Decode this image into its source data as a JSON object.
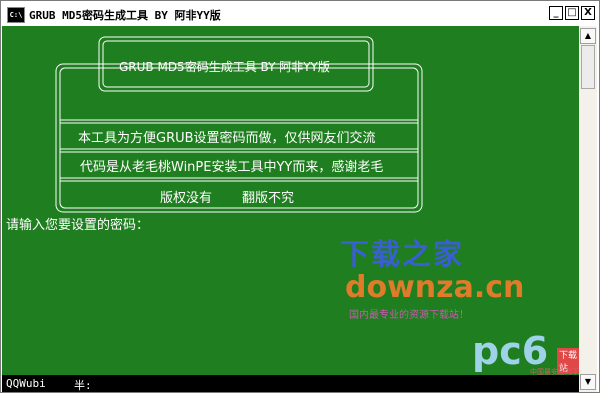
{
  "window": {
    "icon_label": "C:\\",
    "title": "GRUB MD5密码生成工具 BY 阿非YY版",
    "controls": {
      "minimize": "_",
      "maximize": "□",
      "close": "X"
    }
  },
  "console": {
    "banner_title": "GRUB MD5密码生成工具 BY 阿非YY版",
    "line1": "本工具为方便GRUB设置密码而做，仅供网友们交流",
    "line2": "代码是从老毛桃WinPE安装工具中YY而来，感谢老毛",
    "line3a": "版权没有",
    "line3b": "翻版不究",
    "prompt": "请输入您要设置的密码："
  },
  "watermark": {
    "cn": "下载之家",
    "en": "downza.cn",
    "sub": "国内最专业的资源下载站！",
    "pc6": "pc6",
    "pc6_badge": "下载站",
    "pc6_sub": "中国最安全的下载站"
  },
  "statusbar": {
    "ime_name": "QQWubi",
    "ime_mode": "半:"
  },
  "scrollbar": {
    "up": "▲",
    "down": "▼"
  },
  "colors": {
    "console_bg": "#1f7e1f",
    "text": "#ffffff"
  }
}
